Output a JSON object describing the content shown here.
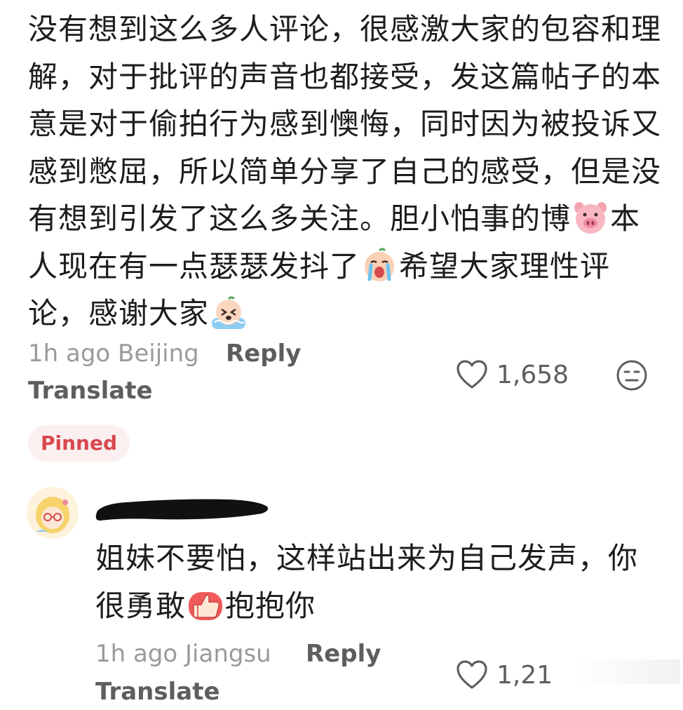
{
  "comment_1": {
    "lines": [
      "没有想到这么多人评论，很感激大家的包容和理",
      "解，对于批评的声音也都接受，发这篇帖子的本",
      "意是对于偷拍行为感到懊悔，同时因为被投诉又",
      "感到憋屈，所以简单分享了自己的感受，但是没",
      "有想到引发了这么多关注。胆小怕事的博",
      "本",
      "人现在有一点瑟瑟发抖了",
      "希望大家理性评",
      "论，感谢大家"
    ],
    "emojis": [
      "pig-face-icon",
      "crying-face-icon",
      "sobbing-face-icon"
    ],
    "time_location": "1h ago Beijing",
    "reply_label": "Reply",
    "translate_label": "Translate",
    "like_count": "1,658",
    "pinned_label": "Pinned"
  },
  "comment_2": {
    "lines": [
      "姐妹不要怕，这样站出来为自己发声，你",
      "很勇敢",
      "抱抱你"
    ],
    "emojis": [
      "thumbs-up-icon"
    ],
    "time_location": "1h ago Jiangsu",
    "reply_label": "Reply",
    "translate_label": "Translate",
    "like_count": "1,21"
  },
  "colors": {
    "text_primary": "#1d1d1d",
    "text_meta": "#9a9a9a",
    "text_action": "#5e5e5e",
    "pinned_bg": "#fbeff0",
    "pinned_text": "#d9484f"
  }
}
